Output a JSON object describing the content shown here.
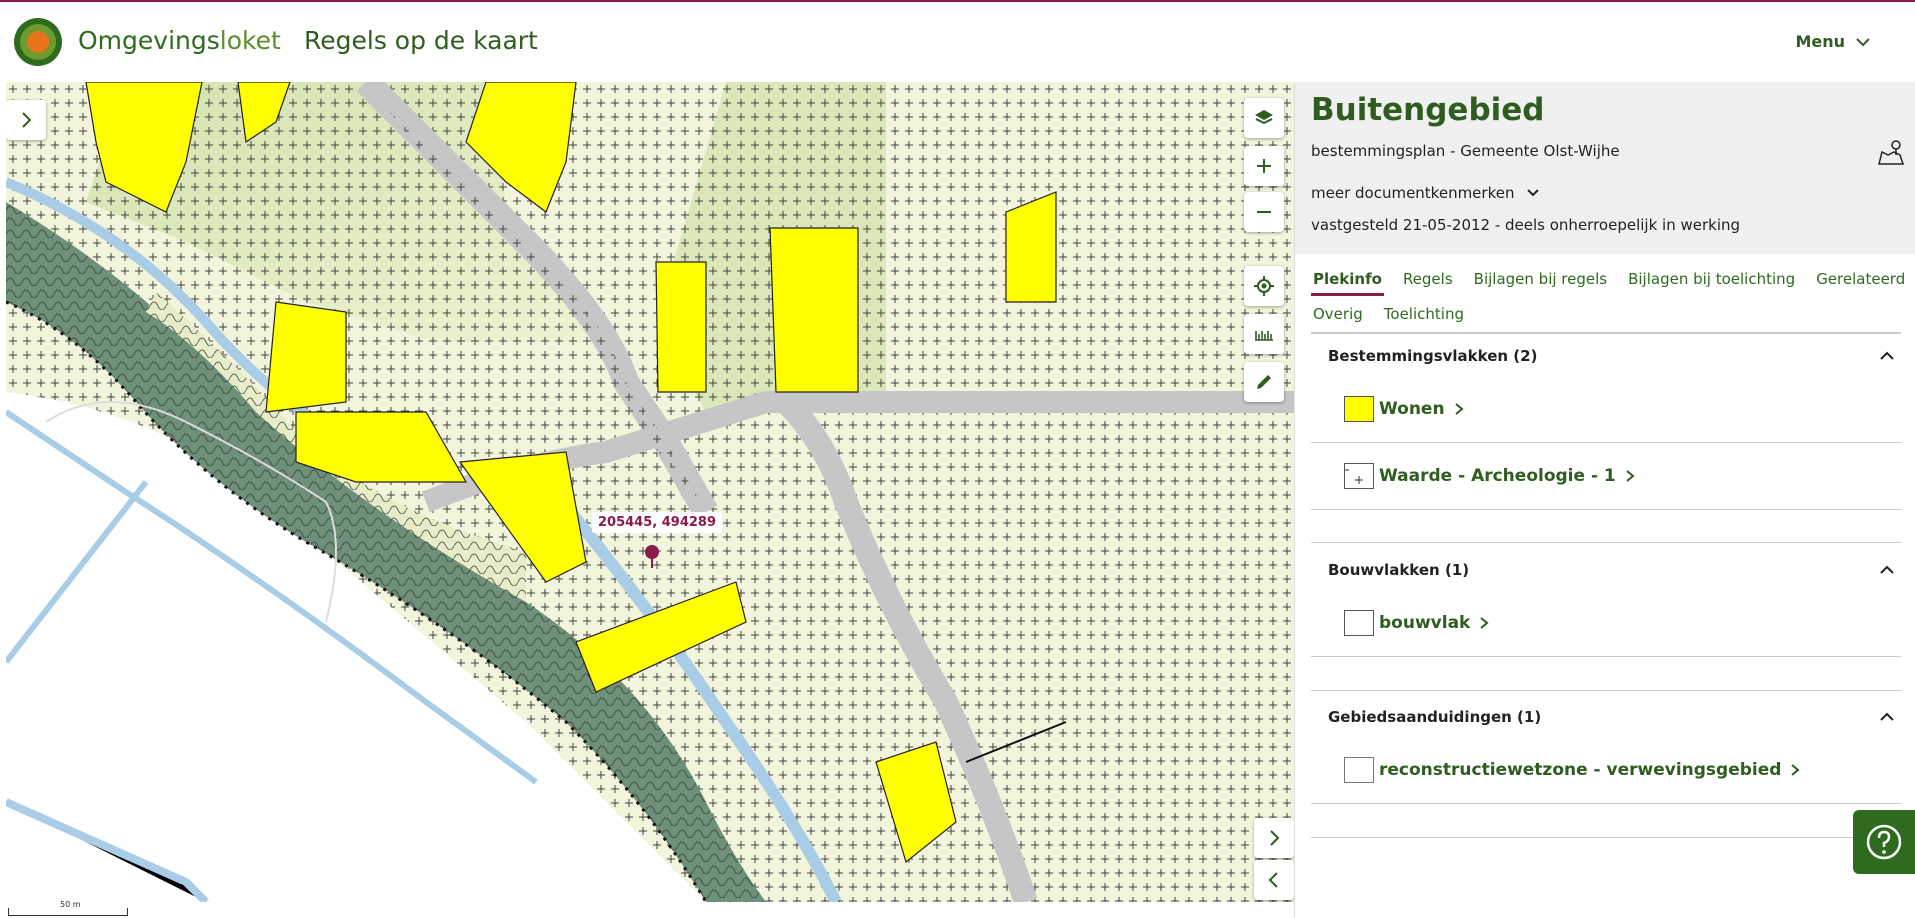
{
  "header": {
    "brand_part1": "Omgevings",
    "brand_part2": "loket",
    "app_title": "Regels op de kaart",
    "menu_label": "Menu"
  },
  "map": {
    "coordinate_label": "205445, 494289",
    "scale_label": "50 m",
    "colors": {
      "wonen": "#ffff00",
      "agrarisch": "#f2f4dc",
      "groen": "#6e8f78",
      "water": "#a9cde6",
      "weg": "#c6c6c6",
      "pin": "#8b1a4a"
    }
  },
  "panel": {
    "title": "Buitengebied",
    "subtitle": "bestemmingsplan - Gemeente Olst-Wijhe",
    "meer_label": "meer documentkenmerken",
    "status": "vastgesteld 21-05-2012 - deels onherroepelijk in werking",
    "tabs_row1": [
      "Plekinfo",
      "Regels",
      "Bijlagen bij regels",
      "Bijlagen bij toelichting",
      "Gerelateerd"
    ],
    "tabs_row2": [
      "Overig",
      "Toelichting"
    ],
    "active_tab": "Plekinfo",
    "sections": [
      {
        "title": "Bestemmingsvlakken (2)",
        "items": [
          {
            "label": "Wonen",
            "swatch": "yellow"
          },
          {
            "label": "Waarde - Archeologie - 1",
            "swatch": "cross"
          }
        ]
      },
      {
        "title": "Bouwvlakken (1)",
        "items": [
          {
            "label": "bouwvlak",
            "swatch": "white"
          }
        ]
      },
      {
        "title": "Gebiedsaanduidingen (1)",
        "items": [
          {
            "label": "reconstructiewetzone - verwevingsgebied",
            "swatch": "white-light"
          }
        ]
      }
    ]
  }
}
